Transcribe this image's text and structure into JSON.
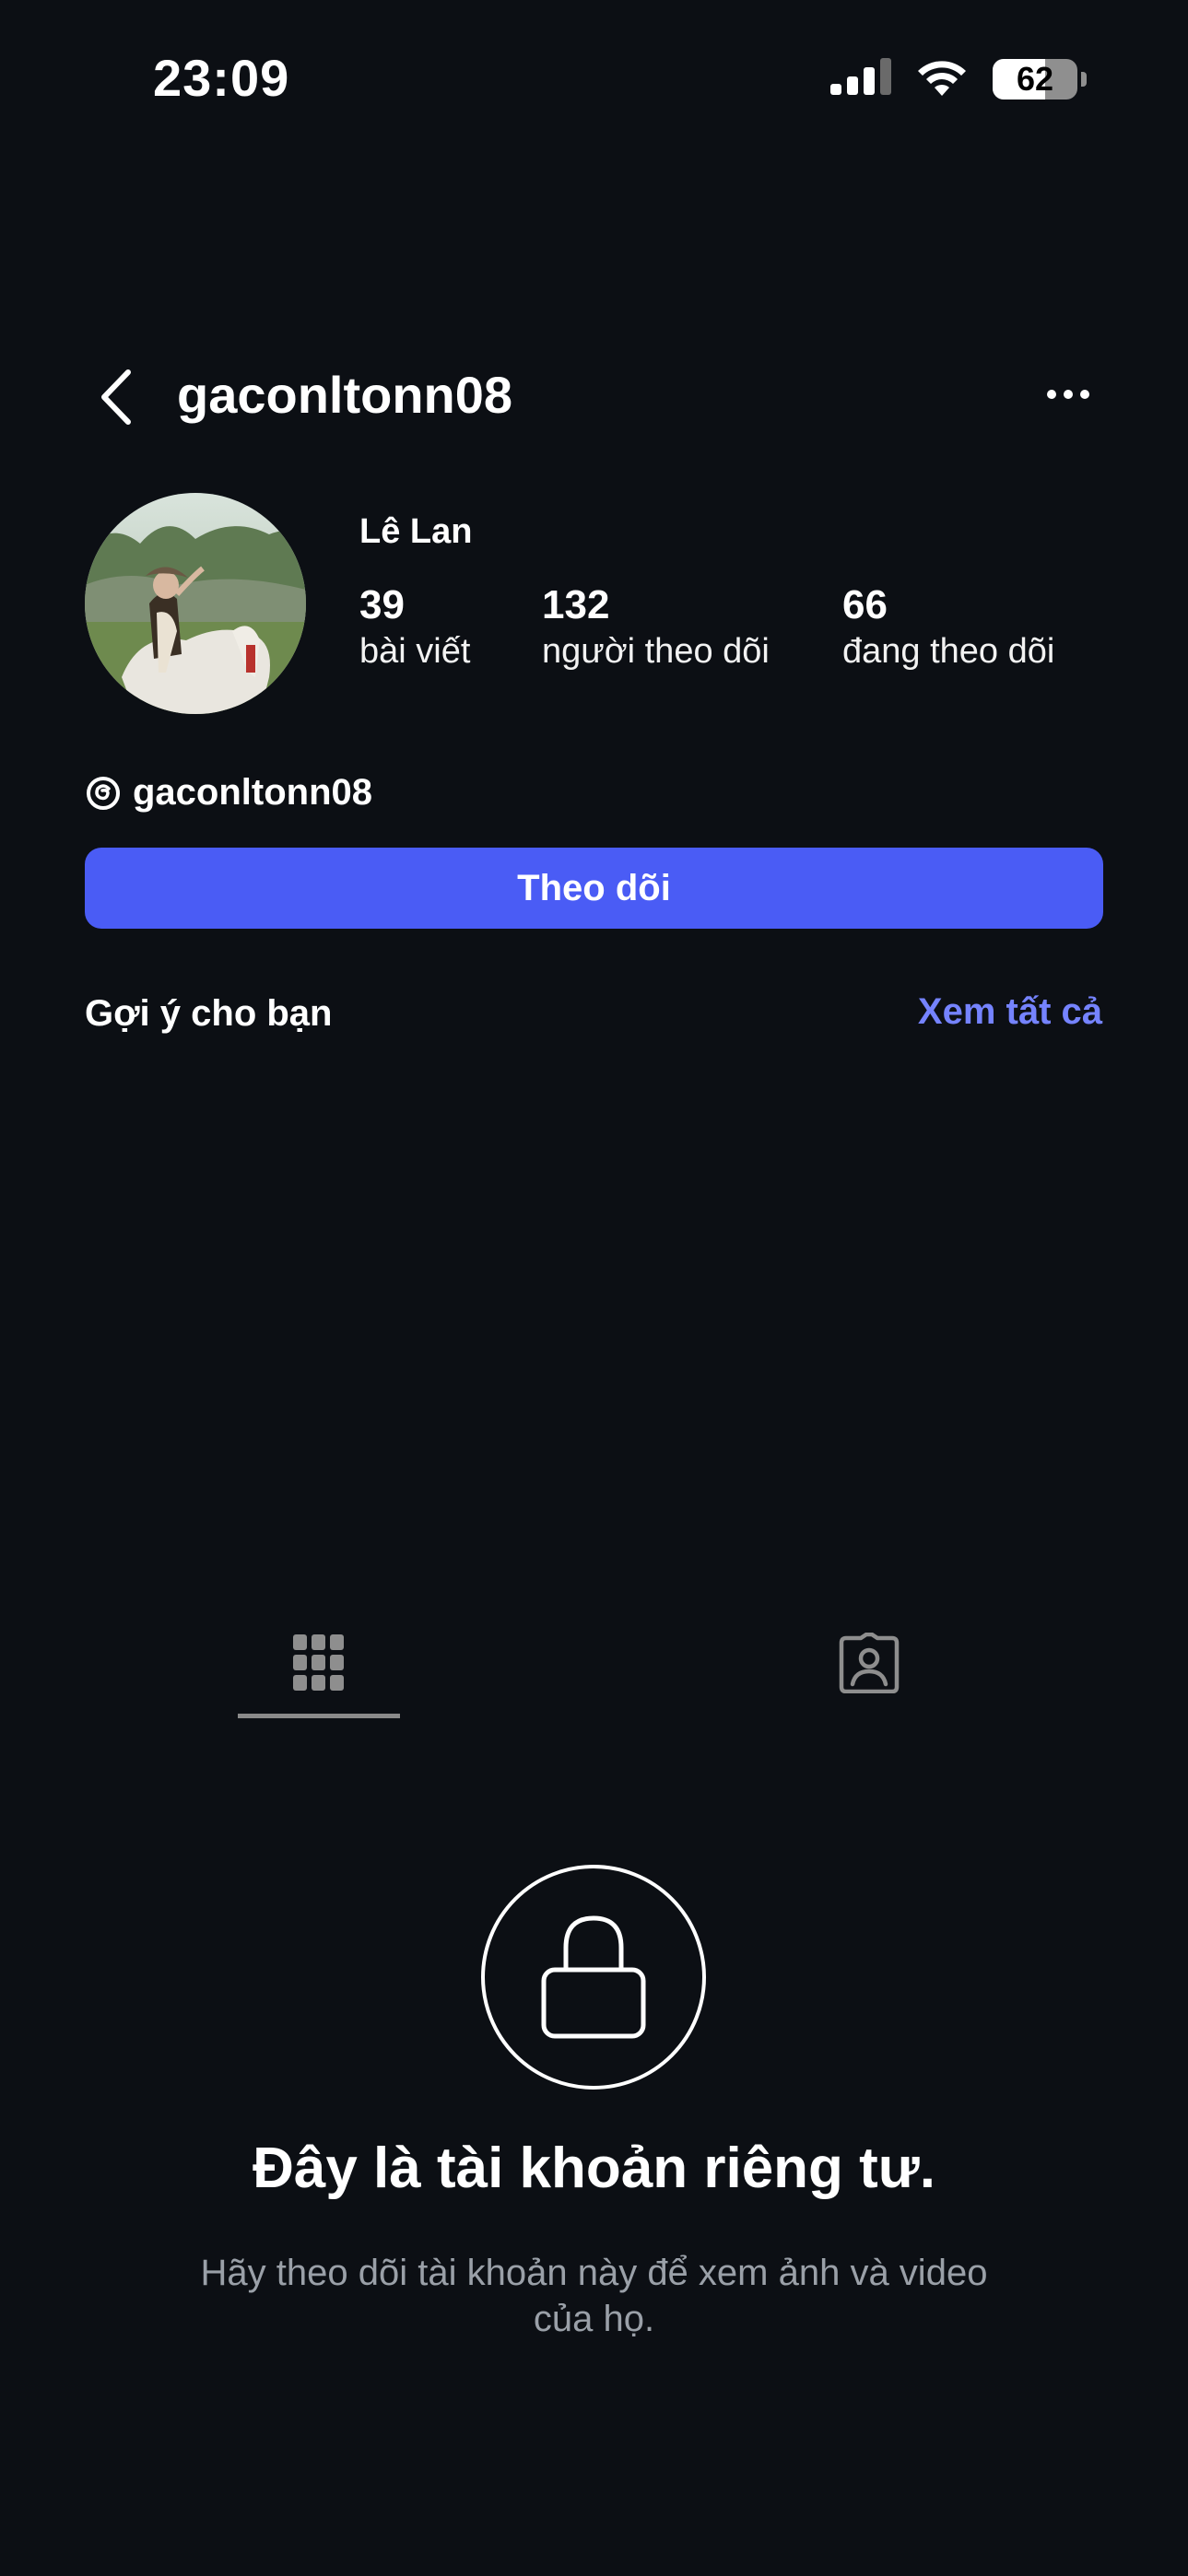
{
  "status_bar": {
    "time": "23:09",
    "battery": "62",
    "icons": [
      "signal-icon",
      "wifi-icon",
      "battery-icon"
    ]
  },
  "header": {
    "username": "gaconltonn08",
    "back_icon": "chevron-left-icon",
    "more_icon": "ellipsis-icon"
  },
  "profile": {
    "full_name": "Lê Lan",
    "stats": {
      "posts": {
        "value": "39",
        "label": "bài viết"
      },
      "followers": {
        "value": "132",
        "label": "người theo dõi"
      },
      "following": {
        "value": "66",
        "label": "đang theo dõi"
      }
    },
    "threads_handle": "gaconltonn08",
    "follow_label": "Theo dõi"
  },
  "suggestions": {
    "title": "Gợi ý cho bạn",
    "see_all": "Xem tất cả"
  },
  "tabs": {
    "active": "grid",
    "items": [
      "grid-icon",
      "tagged-icon"
    ]
  },
  "private": {
    "title": "Đây là tài khoản riêng tư.",
    "subtitle": "Hãy theo dõi tài khoản này để xem ảnh và video của họ."
  },
  "colors": {
    "background": "#0c0f14",
    "accent": "#4a5cf5",
    "link": "#7583ff"
  }
}
